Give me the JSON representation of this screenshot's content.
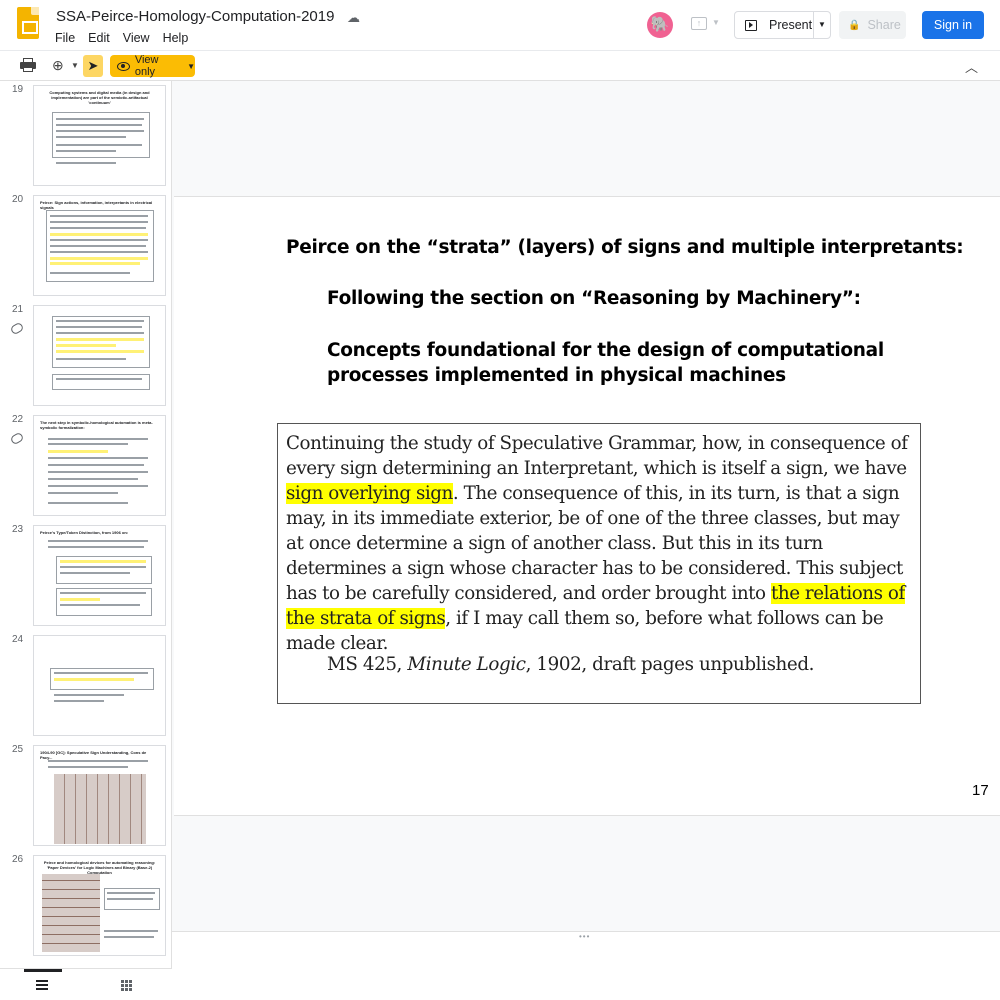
{
  "app": {
    "title": "SSA-Peirce-Homology-Computation-2019",
    "menu": [
      "File",
      "Edit",
      "View",
      "Help"
    ],
    "avatar_icon": "pink-animal-avatar",
    "accent": "#1a73e8"
  },
  "header": {
    "present_label": "Present",
    "share_label": "Share",
    "signin_label": "Sign in"
  },
  "toolbar": {
    "view_only_label": "View only",
    "view_only_color": "#fbbc04"
  },
  "filmstrip": {
    "slides": [
      {
        "number": "19",
        "title": "Computing systems and digital media (in design and implementation) are part of the semiotic-artifactual 'continuum'"
      },
      {
        "number": "20",
        "title": "Peirce: Sign actions, information, interpretants in electrical signals"
      },
      {
        "number": "21",
        "title": ""
      },
      {
        "number": "22",
        "title": "The next step in symbolic-homological automation is meta-symbolic formalization:"
      },
      {
        "number": "23",
        "title": "Peirce's Type/Token Distinction, from 1906 on:"
      },
      {
        "number": "24",
        "title": ""
      },
      {
        "number": "25",
        "title": "1904-90 [GC]: Speculative Sign Understanding, Cons de Pacy..."
      },
      {
        "number": "26",
        "title": "Peirce and homological devices for automating reasoning: 'Paper Devices' for Logic Machines and Binary (Base-2) Computation"
      }
    ]
  },
  "slide": {
    "title": "Peirce on the “strata” (layers) of signs and multiple interpretants:",
    "subtitle1": "Following the section on “Reasoning by Machinery”:",
    "subtitle2": "Concepts foundational for the design of computational processes implemented in physical machines",
    "quote_part1": "Continuing the study of Speculative Grammar, how, in consequence of every sign determining an Interpretant, which is itself a sign, we have ",
    "quote_hl1": "sign overlying sign",
    "quote_part2": ". The consequence of this, in its turn, is that a sign may, in its immediate exterior, be of one of the three classes, but may at once determine a sign of another class. But this in its turn determines a sign whose character has to be considered. This subject has to be carefully considered, and order brought into ",
    "quote_hl2": "the relations of the strata of signs",
    "quote_part3": ", if I may call them so, before what follows can be made clear.",
    "citation_pre": "MS 425, ",
    "citation_italic": "Minute Logic",
    "citation_post": ", 1902, draft pages unpublished.",
    "page_number": "17"
  }
}
